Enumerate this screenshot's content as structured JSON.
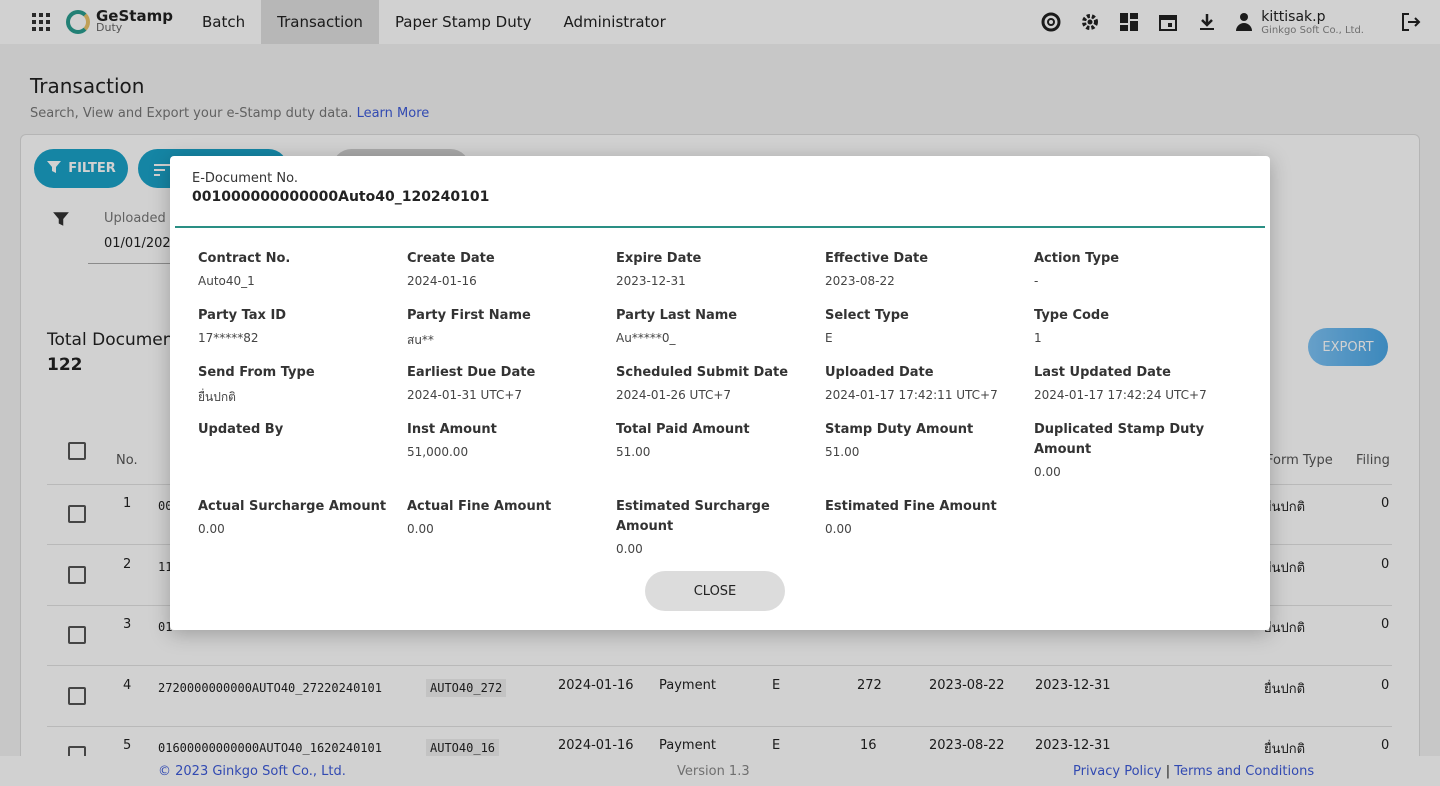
{
  "header": {
    "logo_main": "GeStamp",
    "logo_sub": "Duty",
    "nav": [
      "Batch",
      "Transaction",
      "Paper Stamp Duty",
      "Administrator"
    ],
    "active_nav": "Transaction",
    "user_name": "kittisak.p",
    "user_org": "Ginkgo Soft Co., Ltd."
  },
  "page": {
    "title": "Transaction",
    "subtitle": "Search, View and Export your e-Stamp duty data.",
    "learn_more": "Learn More",
    "filter_button": "FILTER",
    "uploaded_label": "Uploaded",
    "uploaded_value": "01/01/2024",
    "total_label": "Total Documen",
    "total_value": "122",
    "export_button": "EXPORT"
  },
  "table": {
    "headers": {
      "no": "No.",
      "form_type": "Form Type",
      "filing": "Filing"
    },
    "rows": [
      {
        "no": "1",
        "doc": "00",
        "contract": "",
        "create": "",
        "action": "",
        "sel": "",
        "type": "",
        "eff": "",
        "exp": "",
        "form": "ยื่นปกติ",
        "filing": "0"
      },
      {
        "no": "2",
        "doc": "11",
        "contract": "",
        "create": "",
        "action": "",
        "sel": "",
        "type": "",
        "eff": "",
        "exp": "",
        "form": "ยื่นปกติ",
        "filing": "0"
      },
      {
        "no": "3",
        "doc": "01",
        "contract": "",
        "create": "",
        "action": "",
        "sel": "",
        "type": "",
        "eff": "",
        "exp": "",
        "form": "ยื่นปกติ",
        "filing": "0"
      },
      {
        "no": "4",
        "doc": "2720000000000AUTO40_27220240101",
        "contract": "AUTO40_272",
        "create": "2024-01-16",
        "action": "Payment",
        "sel": "E",
        "type": "272",
        "eff": "2023-08-22",
        "exp": "2023-12-31",
        "form": "ยื่นปกติ",
        "filing": "0"
      },
      {
        "no": "5",
        "doc": "01600000000000AUTO40_1620240101",
        "contract": "AUTO40_16",
        "create": "2024-01-16",
        "action": "Payment",
        "sel": "E",
        "type": "16",
        "eff": "2023-08-22",
        "exp": "2023-12-31",
        "form": "ยื่นปกติ",
        "filing": "0"
      }
    ]
  },
  "footer": {
    "copyright": "© 2023 Ginkgo Soft Co., Ltd.",
    "version": "Version 1.3",
    "privacy": "Privacy Policy",
    "sep": "|",
    "terms": "Terms and Conditions"
  },
  "modal": {
    "doc_label": "E-Document No.",
    "doc_no": "001000000000000Auto40_120240101",
    "fields": [
      {
        "label": "Contract No.",
        "value": "Auto40_1"
      },
      {
        "label": "Create Date",
        "value": "2024-01-16"
      },
      {
        "label": "Expire Date",
        "value": "2023-12-31"
      },
      {
        "label": "Effective Date",
        "value": "2023-08-22"
      },
      {
        "label": "Action Type",
        "value": "-"
      },
      {
        "label": "Party Tax ID",
        "value": "17*****82"
      },
      {
        "label": "Party First Name",
        "value": "สu**"
      },
      {
        "label": "Party Last Name",
        "value": "Au*****0_"
      },
      {
        "label": "Select Type",
        "value": "E"
      },
      {
        "label": "Type Code",
        "value": "1"
      },
      {
        "label": "Send From Type",
        "value": "ยื่นปกติ"
      },
      {
        "label": "Earliest Due Date",
        "value": "2024-01-31 UTC+7"
      },
      {
        "label": "Scheduled Submit Date",
        "value": "2024-01-26 UTC+7"
      },
      {
        "label": "Uploaded Date",
        "value": "2024-01-17 17:42:11 UTC+7"
      },
      {
        "label": "Last Updated Date",
        "value": "2024-01-17 17:42:24 UTC+7"
      },
      {
        "label": "Updated By",
        "value": ""
      },
      {
        "label": "Inst Amount",
        "value": "51,000.00"
      },
      {
        "label": "Total Paid Amount",
        "value": "51.00"
      },
      {
        "label": "Stamp Duty Amount",
        "value": "51.00"
      },
      {
        "label": "Duplicated Stamp Duty Amount",
        "value": "0.00"
      },
      {
        "label": "Actual Surcharge Amount",
        "value": "0.00"
      },
      {
        "label": "Actual Fine Amount",
        "value": "0.00"
      },
      {
        "label": "Estimated Surcharge Amount",
        "value": "0.00"
      },
      {
        "label": "Estimated Fine Amount",
        "value": "0.00"
      }
    ],
    "close_button": "CLOSE"
  }
}
